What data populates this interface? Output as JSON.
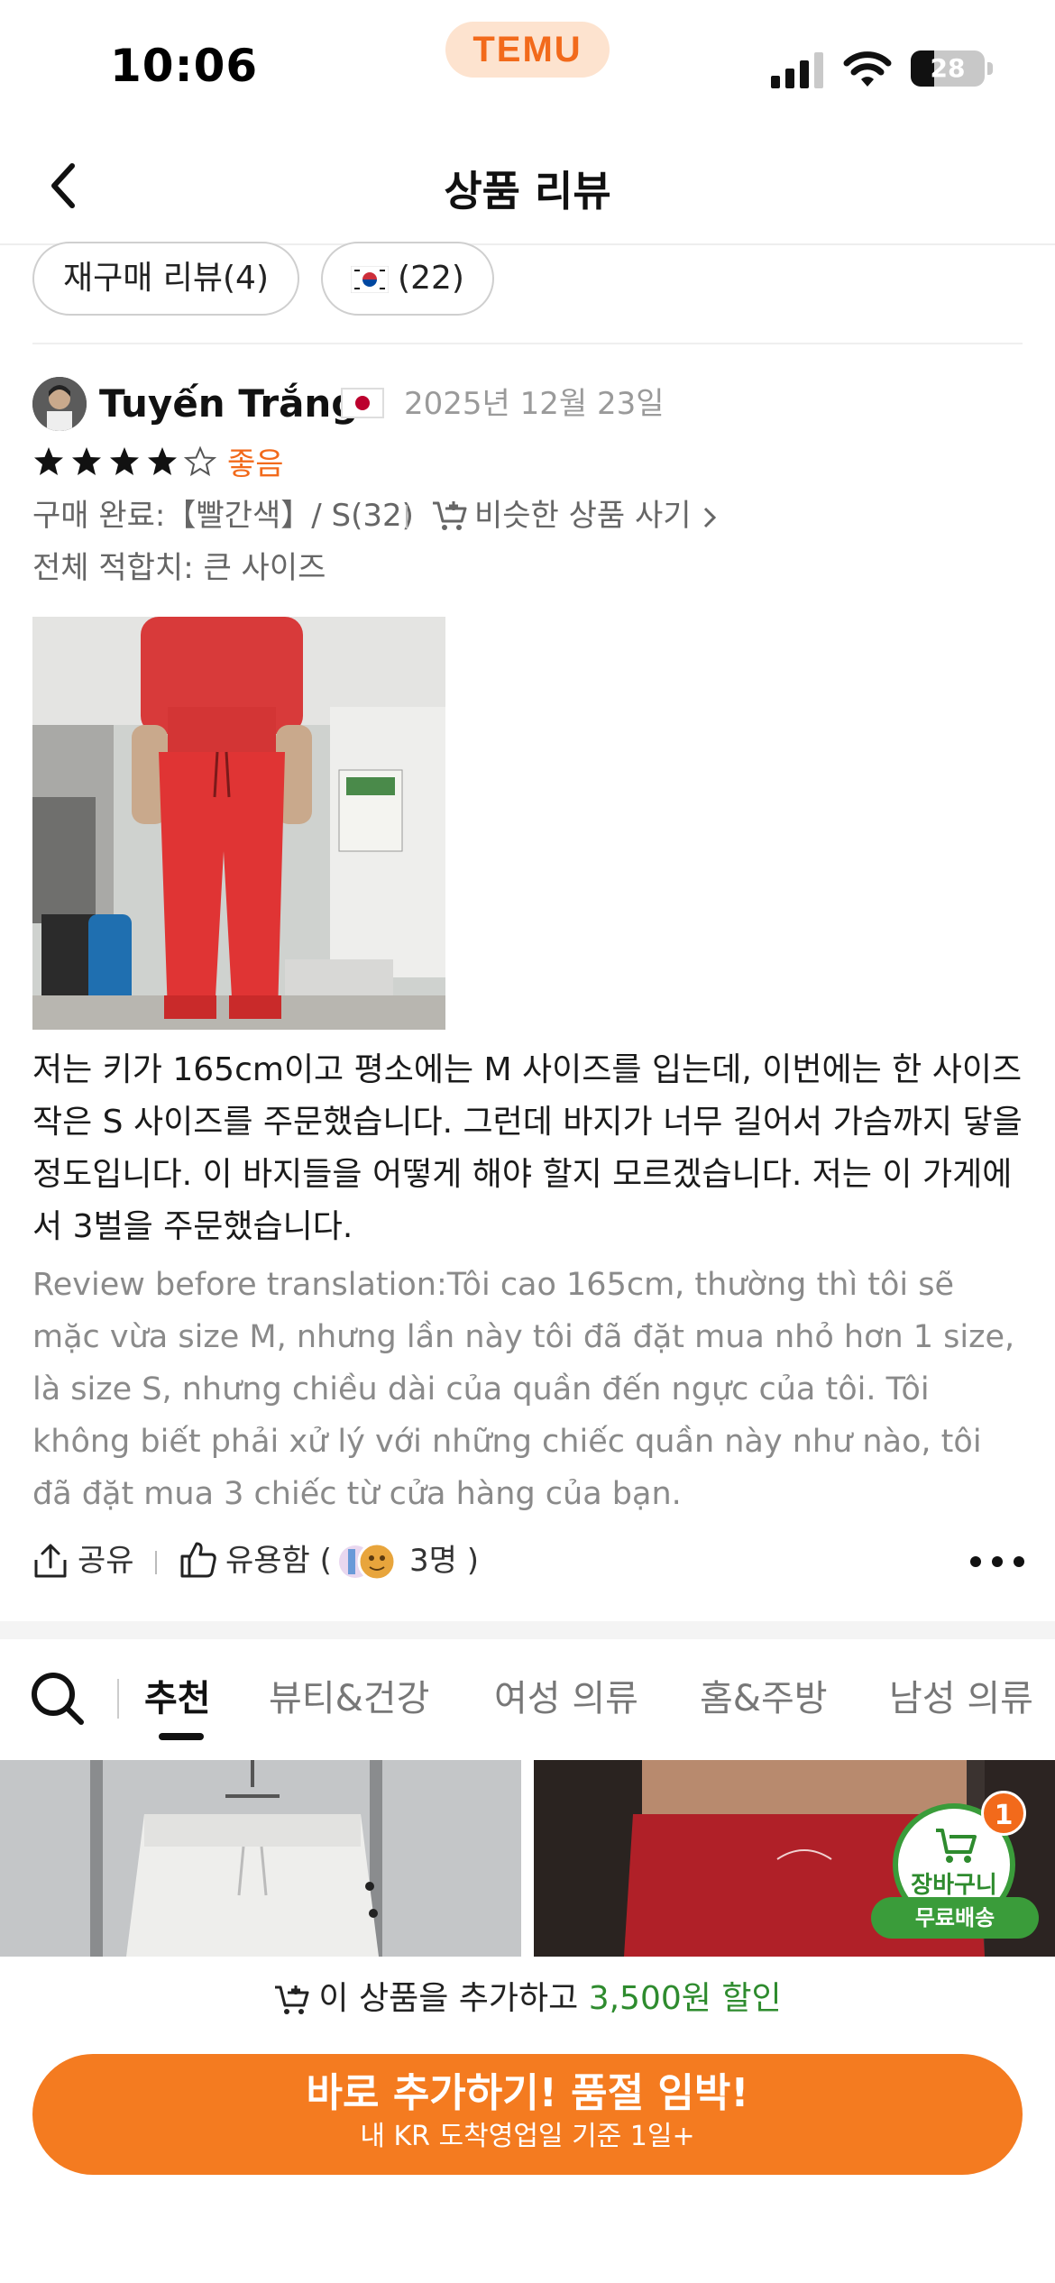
{
  "status_bar": {
    "time": "10:06",
    "app_badge": "TEMU",
    "battery": "28",
    "icons": [
      "signal-icon",
      "wifi-icon",
      "battery-icon"
    ]
  },
  "header": {
    "title": "상품 리뷰",
    "back_icon": "chevron-left-icon"
  },
  "filters": [
    {
      "label": "재구매 리뷰(4)"
    },
    {
      "label": "(22)",
      "icon": "flag-kr-icon"
    }
  ],
  "review": {
    "reviewer_name": "Tuyến Trắng",
    "country_flag": "flag-jp-icon",
    "date": "2025년 12월 23일",
    "rating": 4,
    "rating_max": 5,
    "rating_label": "좋음",
    "purchase_info": "구매 완료:【빨간색】/ S(32)",
    "similar_link": "비슷한 상품 사기",
    "fit": "전체 적합치: 큰 사이즈",
    "text": "저는 키가 165cm이고 평소에는 M 사이즈를 입는데, 이번에는 한 사이즈 작은 S 사이즈를 주문했습니다. 그런데 바지가 너무 길어서 가슴까지 닿을 정도입니다. 이 바지들을 어떻게 해야 할지 모르겠습니다. 저는 이 가게에서 3벌을 주문했습니다.",
    "original_text": "Review before translation:Tôi cao 165cm, thường thì tôi sẽ mặc vừa size M, nhưng lần này tôi đã đặt mua nhỏ hơn 1 size, là size S, nhưng chiều dài của quần đến ngực của tôi. Tôi không biết phải xử lý với những chiếc quần này như nào, tôi đã đặt mua 3 chiếc từ cửa hàng của bạn.",
    "share_label": "공유",
    "helpful_label": "유용함 (",
    "helpful_count": "3명 )"
  },
  "categories": {
    "tabs": [
      "추천",
      "뷰티&건강",
      "여성 의류",
      "홈&주방",
      "남성 의류"
    ],
    "active_index": 0
  },
  "cart": {
    "label": "장바구니",
    "badge": "1",
    "free_shipping": "무료배송"
  },
  "bottom_bar": {
    "promo_prefix": "이 상품을 추가하고 ",
    "promo_highlight": "3,500원 할인",
    "cta_main": "바로 추가하기! 품절 임박!",
    "cta_sub": "내 KR 도착영업일 기준 1일+"
  },
  "colors": {
    "accent": "#f47b20",
    "rating_label": "#f26a1b",
    "green": "#2e8b2e"
  }
}
